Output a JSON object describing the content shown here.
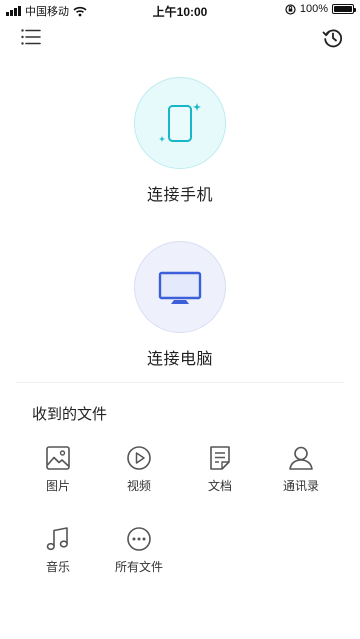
{
  "status_bar": {
    "carrier": "中国移动",
    "time": "上午10:00",
    "battery": "100%",
    "battery_level": 1.0
  },
  "header": {
    "menu_icon": "list-icon",
    "history_icon": "history-icon"
  },
  "connect_phone": {
    "label": "连接手机",
    "icon": "phone-icon",
    "accent": "#18b6c9"
  },
  "connect_pc": {
    "label": "连接电脑",
    "icon": "monitor-icon",
    "accent": "#3d5fd9"
  },
  "received_files": {
    "title": "收到的文件",
    "items": [
      {
        "label": "图片",
        "icon": "image-icon"
      },
      {
        "label": "视频",
        "icon": "play-icon"
      },
      {
        "label": "文档",
        "icon": "document-icon"
      },
      {
        "label": "通讯录",
        "icon": "contact-icon"
      },
      {
        "label": "音乐",
        "icon": "music-icon"
      },
      {
        "label": "所有文件",
        "icon": "more-icon"
      }
    ]
  }
}
